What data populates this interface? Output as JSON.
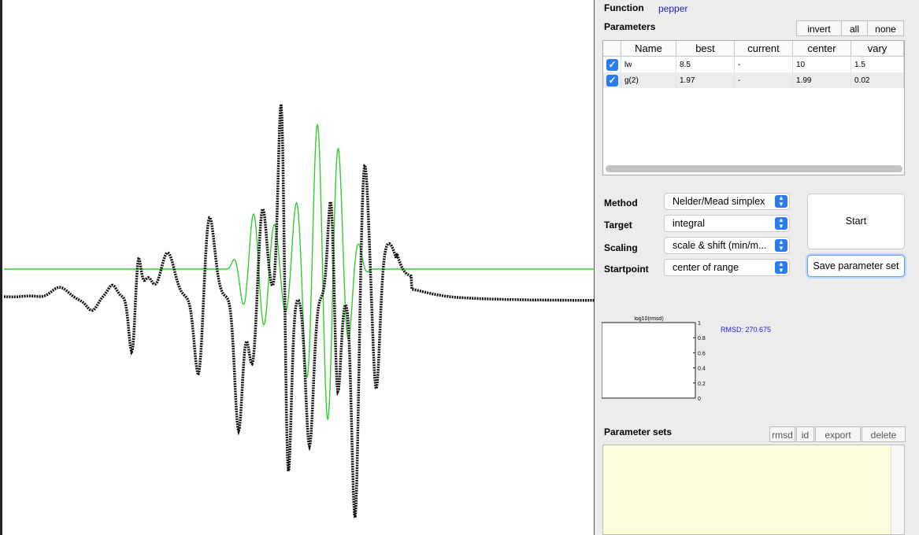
{
  "function": {
    "label": "Function",
    "value": "pepper"
  },
  "parameters": {
    "label": "Parameters",
    "buttons": [
      "invert",
      "all",
      "none"
    ],
    "columns": [
      "",
      "Name",
      "best",
      "current",
      "center",
      "vary"
    ],
    "rows": [
      {
        "checked": true,
        "name": "lw",
        "best": "8.5",
        "current": "-",
        "center": "10",
        "vary": "1.5"
      },
      {
        "checked": true,
        "name": "g(2)",
        "best": "1.97",
        "current": "-",
        "center": "1.99",
        "vary": "0.02"
      }
    ]
  },
  "settings": {
    "method": {
      "label": "Method",
      "value": "Nelder/Mead simplex"
    },
    "target": {
      "label": "Target",
      "value": "integral"
    },
    "scaling": {
      "label": "Scaling",
      "value": "scale & shift (min/m..."
    },
    "startpoint": {
      "label": "Startpoint",
      "value": "center of range"
    }
  },
  "actions": {
    "start": "Start",
    "save": "Save parameter set"
  },
  "rmsd_plot": {
    "title": "log10(rmsd)",
    "yticks": [
      "1",
      "0.8",
      "0.6",
      "0.4",
      "0.2",
      "0"
    ],
    "rmsd_text": "RMSD: 270.675"
  },
  "parameter_sets": {
    "label": "Parameter sets",
    "buttons": [
      "rmsd",
      "id",
      "export",
      "delete"
    ]
  },
  "colors": {
    "data": "#111111",
    "fit": "#33cc33",
    "accent": "#2a7cf0",
    "rmsd_text": "#1a1adc"
  }
}
